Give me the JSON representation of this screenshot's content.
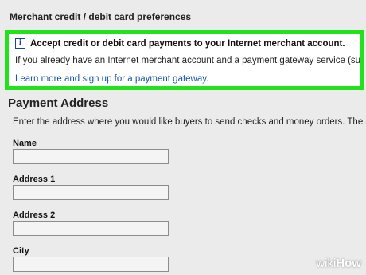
{
  "merchant_prefs": {
    "title": "Merchant credit / debit card preferences"
  },
  "info_box": {
    "icon": "info-icon",
    "icon_glyph": "i",
    "headline": "Accept credit or debit card payments to your Internet merchant account.",
    "body": "If you already have an Internet merchant account and a payment gateway service (such",
    "link": "Learn more and sign up for a payment gateway.",
    "border_color": "#22e21b"
  },
  "payment_address": {
    "title": "Payment Address",
    "description": "Enter the address where you would like buyers to send checks and money orders. The a",
    "fields": [
      {
        "label": "Name",
        "value": ""
      },
      {
        "label": "Address 1",
        "value": ""
      },
      {
        "label": "Address 2",
        "value": ""
      },
      {
        "label": "City",
        "value": ""
      }
    ]
  },
  "watermark": {
    "prefix": "wiki",
    "suffix": "How"
  }
}
